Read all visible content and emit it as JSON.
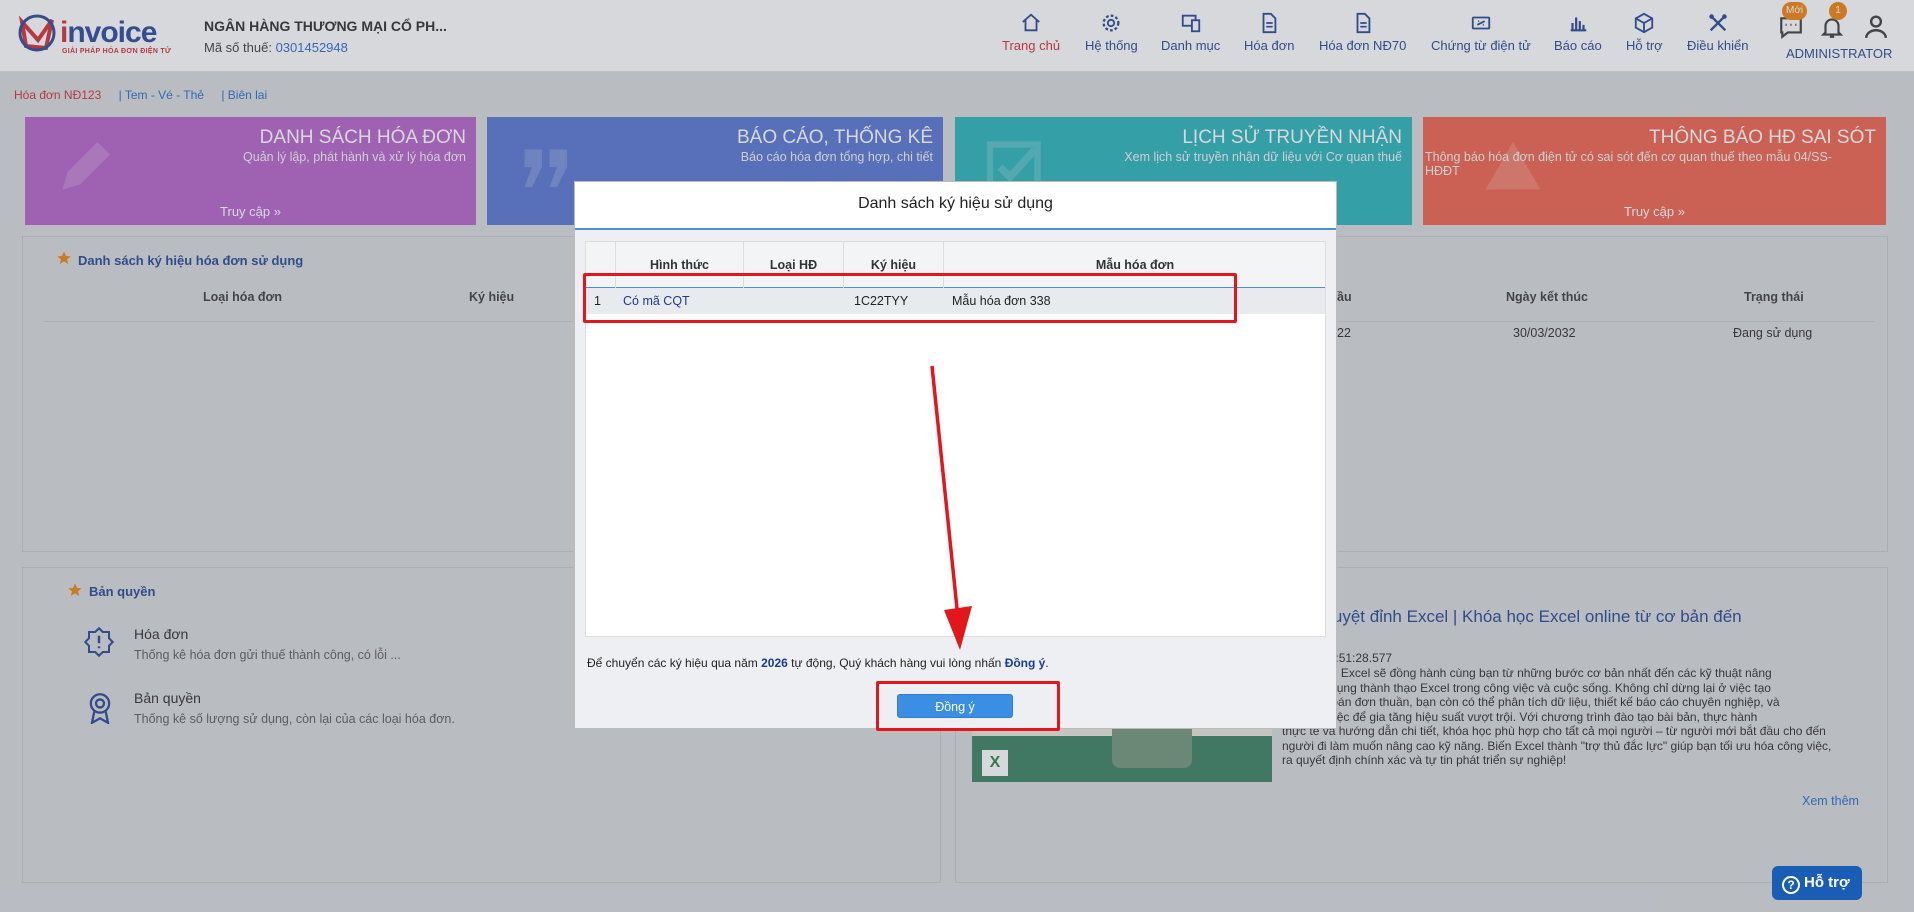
{
  "header": {
    "logo_text_part1": "i",
    "logo_text_part2": "nvoice",
    "logo_tagline": "GIẢI PHÁP HÓA ĐƠN ĐIỆN TỬ",
    "company_name": "NGÂN HÀNG THƯƠNG MẠI CỔ PH...",
    "tax_label": "Mã số thuế:",
    "tax_code": "0301452948",
    "nav": [
      {
        "label": "Trang chủ",
        "icon": "home-icon"
      },
      {
        "label": "Hệ thống",
        "icon": "gear-icon"
      },
      {
        "label": "Danh mục",
        "icon": "devices-icon"
      },
      {
        "label": "Hóa đơn",
        "icon": "document-icon"
      },
      {
        "label": "Hóa đơn NĐ70",
        "icon": "document-icon"
      },
      {
        "label": "Chứng từ điện tử",
        "icon": "voucher-icon"
      },
      {
        "label": "Báo cáo",
        "icon": "bar-chart-icon"
      },
      {
        "label": "Hỗ trợ",
        "icon": "cube-icon"
      },
      {
        "label": "Điều khiển",
        "icon": "tools-icon"
      }
    ],
    "chat_badge": "Mới",
    "bell_badge": "1",
    "user_label": "ADMINISTRATOR"
  },
  "subtabs": [
    "Hóa đơn NĐ123",
    "| Tem - Vé - Thẻ",
    "| Biên lai"
  ],
  "cards": [
    {
      "title": "DANH SÁCH HÓA ĐƠN",
      "desc": "Quản lý lập, phát hành và xử lý hóa đơn",
      "access": "Truy cập  »",
      "color": "#b25cc8"
    },
    {
      "title": "BÁO CÁO, THỐNG KÊ",
      "desc": "Báo cáo hóa đơn tổng hợp, chi tiết",
      "access": "",
      "color": "#4f6fd0"
    },
    {
      "title": "LỊCH SỬ TRUYỀN NHẬN",
      "desc": "Xem lịch sử truyền nhận dữ liệu với Cơ quan thuế",
      "access": "",
      "color": "#1fb0b8"
    },
    {
      "title": "THÔNG BÁO HĐ SAI SÓT",
      "desc": "Thông báo hóa đơn điện tử có sai sót đến cơ quan thuế theo mẫu 04/SS-HĐĐT",
      "access": "Truy cập  »",
      "color": "#ee5a44"
    }
  ],
  "symbols_panel": {
    "title": "Danh sách ký hiệu hóa đơn sử dụng",
    "headers": [
      "Loại hóa đơn",
      "Ký hiệu",
      "ầu",
      "Ngày kết thúc",
      "Trạng thái"
    ],
    "row": [
      "22",
      "30/03/2032",
      "Đang sử dụng"
    ]
  },
  "license_panel": {
    "title": "Bản quyền",
    "items": [
      {
        "title": "Hóa đơn",
        "sub": "Thống kê hóa đơn gửi thuế thành công, có lỗi ..."
      },
      {
        "title": "Bản quyền",
        "sub": "Thống kê số lượng sử dụng, còn lại của các loại hóa đơn."
      }
    ]
  },
  "news": {
    "title": ": Tuyệt đỉnh Excel | Khóa học Excel online từ cơ bản đến\nao",
    "date": "04-29T14:51:28.577",
    "body": "Tuyệt đỉnh Excel sẽ đồng hành cùng bạn từ những bước cơ bản nhất đến các kỹ thuật nâng\nbản ứng dụng thành thạo Excel trong công việc và cuộc sống. Không chỉ dừng lại ở việc tạo\nhay tính toán đơn thuần, bạn còn có thể phân tích dữ liệu, thiết kế báo cáo chuyên nghiệp, và\nóa công việc để gia tăng hiệu suất vượt trội. Với chương trình đào tạo bài bản, thực hành\nthực tế và hướng dẫn chi tiết, khóa học phù hợp cho tất cả mọi người – từ người mới bắt đầu cho đến\nngười đi làm muốn nâng cao kỹ năng. Biến Excel thành \"trợ thủ đắc lực\" giúp bạn tối ưu hóa công việc,\nra quyết định chính xác và tự tin phát triển sự nghiệp!",
    "more": "Xem thêm"
  },
  "help_button": "Hỗ trợ",
  "modal": {
    "title": "Danh sách ký hiệu sử dụng",
    "columns": [
      "Hình thức",
      "Loại HĐ",
      "Ký hiệu",
      "Mẫu hóa đơn"
    ],
    "rows": [
      {
        "stt": "1",
        "hinh_thuc": "Có mã CQT",
        "loai": "",
        "ky_hieu": "1C22TYY",
        "mau": "Mẫu hóa đơn 338"
      }
    ],
    "notice_pre": "Để chuyển các ký hiệu qua năm",
    "notice_year": "2026",
    "notice_mid": "tự động, Quý khách hàng vui lòng nhấn",
    "notice_action": "Đồng ý",
    "notice_end": ".",
    "ok_label": "Đồng ý"
  },
  "colors": {
    "highlight": "#e3161c",
    "brand_blue": "#1a3d8f",
    "brand_red": "#d2232a"
  }
}
